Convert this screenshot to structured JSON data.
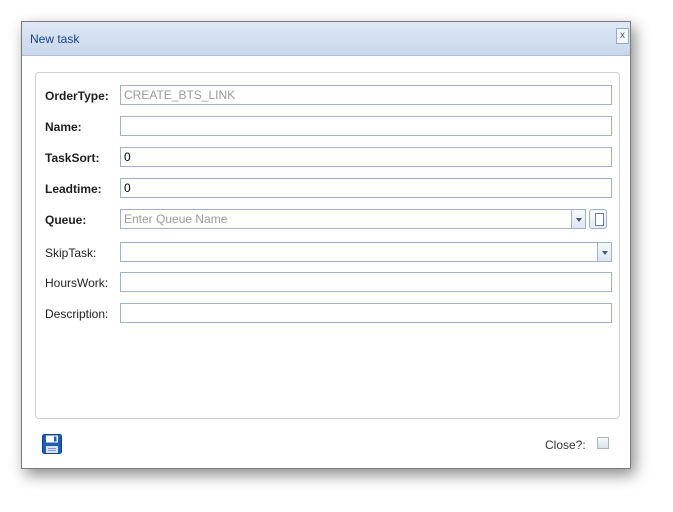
{
  "window": {
    "title": "New task",
    "close_glyph": "x"
  },
  "form": {
    "order_type": {
      "label": "OrderType:",
      "value": "CREATE_BTS_LINK"
    },
    "name": {
      "label": "Name:",
      "value": ""
    },
    "task_sort": {
      "label": "TaskSort:",
      "value": "0"
    },
    "leadtime": {
      "label": "Leadtime:",
      "value": "0"
    },
    "queue": {
      "label": "Queue:",
      "placeholder": "Enter Queue Name"
    },
    "skip_task": {
      "label": "SkipTask:",
      "value": ""
    },
    "hours_work": {
      "label": "HoursWork:",
      "value": ""
    },
    "description": {
      "label": "Description:",
      "value": ""
    }
  },
  "footer": {
    "save_icon": "floppy-disk-icon",
    "close_label": "Close?:",
    "close_checked": false
  },
  "colors": {
    "titlebar": "#c9d7ec",
    "title_text": "#15428b",
    "field_border": "#9fb2cd",
    "save_icon": "#1d5fb8"
  }
}
